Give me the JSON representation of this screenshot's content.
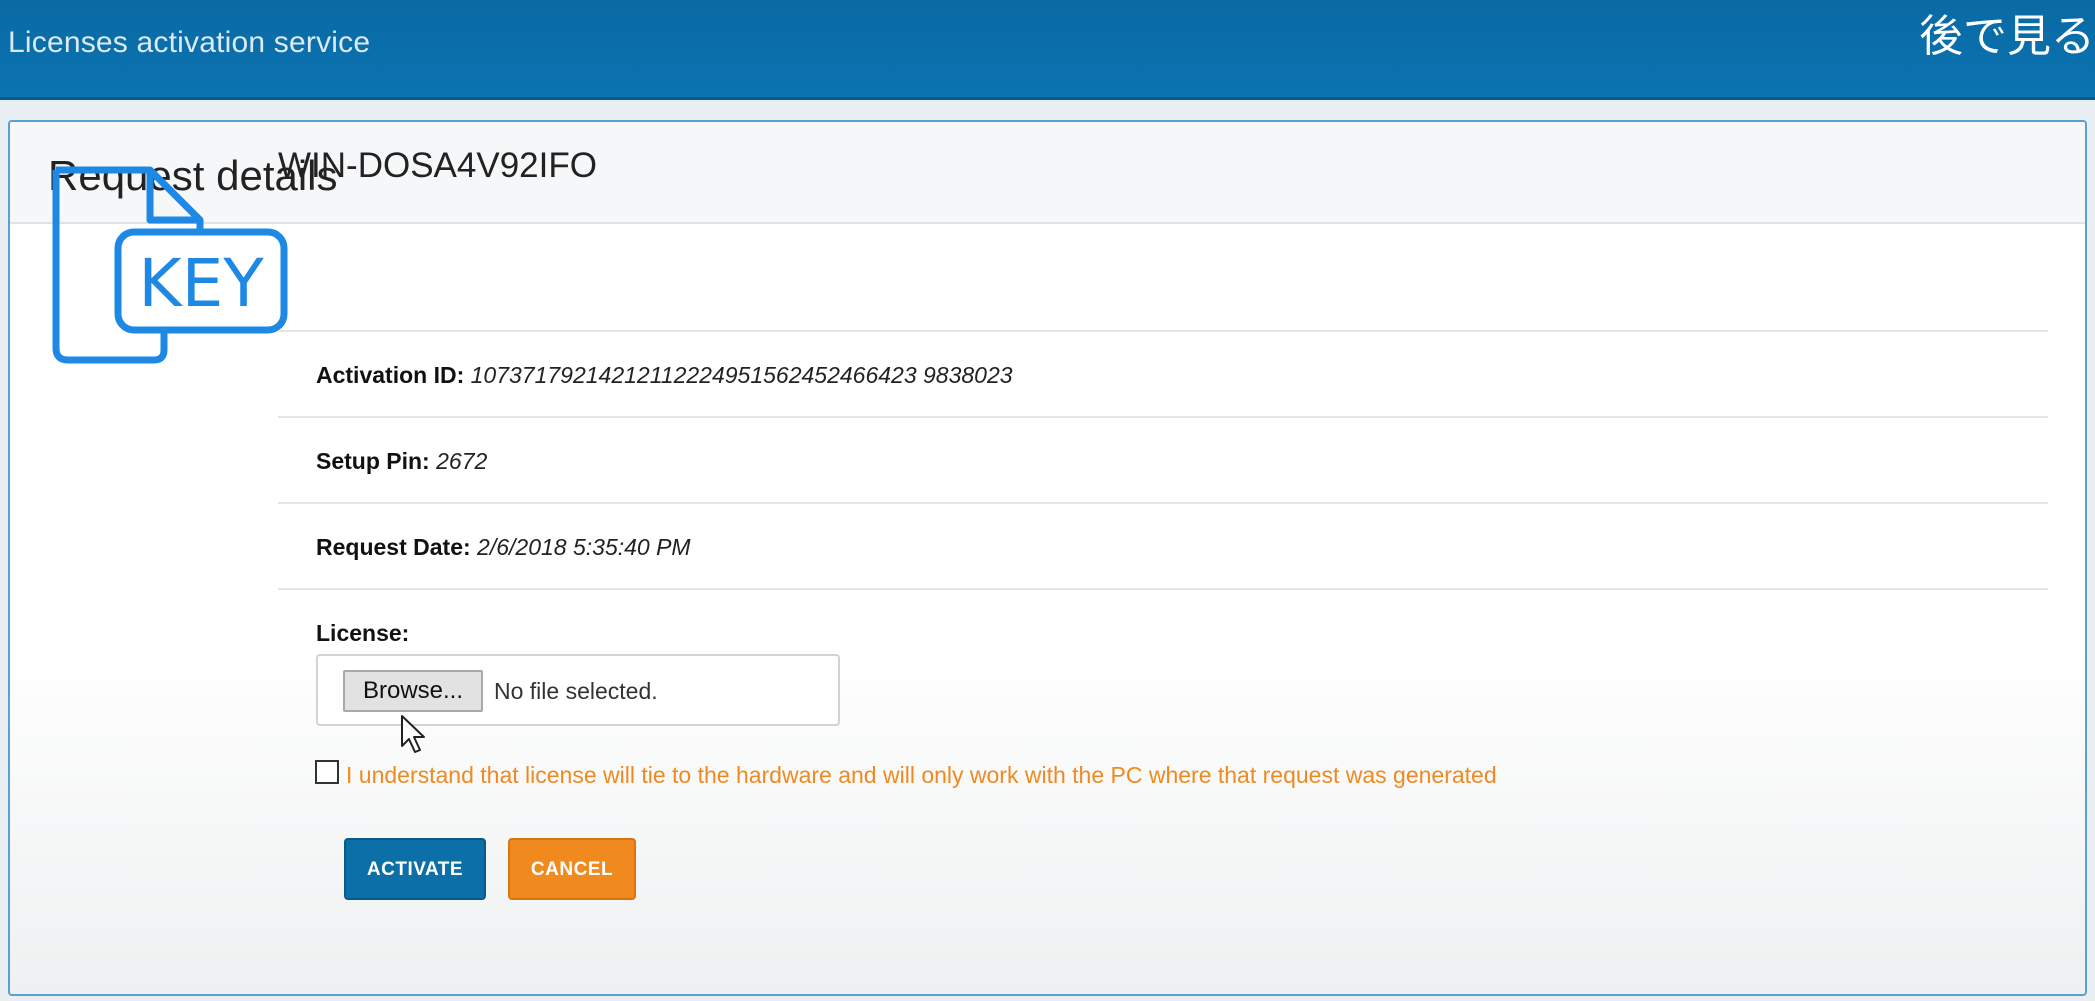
{
  "app": {
    "title": "Licenses activation service"
  },
  "overlay": {
    "text": "後で見る"
  },
  "panel": {
    "title": "Request details"
  },
  "request": {
    "machine_name": "WIN-DOSA4V92IFO",
    "activation_id_label": "Activation ID:",
    "activation_id": "10737179214212112224951562452466423 9838023",
    "setup_pin_label": "Setup Pin:",
    "setup_pin": "2672",
    "request_date_label": "Request Date:",
    "request_date": "2/6/2018 5:35:40 PM"
  },
  "license": {
    "label": "License:",
    "browse_label": "Browse...",
    "no_file_text": "No file selected.",
    "agree_text": "I understand that license will tie to the hardware and will only work with the PC where that request was generated",
    "agree_checked": false
  },
  "actions": {
    "activate_label": "ACTIVATE",
    "cancel_label": "CANCEL"
  },
  "icons": {
    "key_file": "key-file-icon",
    "cursor": "mouse-pointer-icon"
  },
  "colors": {
    "header": "#0b6fab",
    "primary": "#0c6fa8",
    "warning": "#f08a1e",
    "icon": "#1e88e5"
  }
}
